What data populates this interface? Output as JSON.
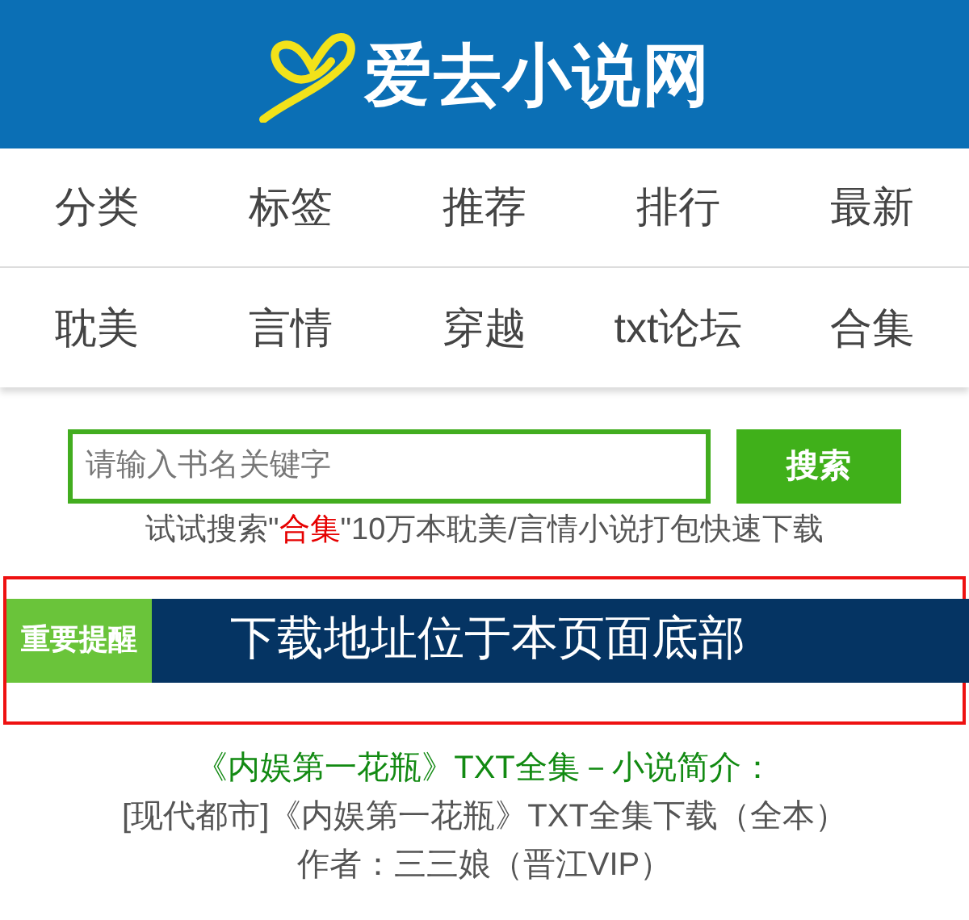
{
  "header": {
    "site_name": "爱去小说网"
  },
  "nav_rows": [
    [
      "分类",
      "标签",
      "推荐",
      "排行",
      "最新"
    ],
    [
      "耽美",
      "言情",
      "穿越",
      "txt论坛",
      "合集"
    ]
  ],
  "search": {
    "placeholder": "请输入书名关键字",
    "button": "搜索"
  },
  "hint": {
    "before": "试试搜索\"",
    "highlight": "合集",
    "after": "\"10万本耽美/言情小说打包快速下载"
  },
  "notice": {
    "badge": "重要提醒",
    "message": "下载地址位于本页面底部"
  },
  "book": {
    "title": "《内娱第一花瓶》TXT全集－小说简介：",
    "subtitle": "[现代都市]《内娱第一花瓶》TXT全集下载（全本）",
    "author": "作者：三三娘（晋江VIP）"
  }
}
